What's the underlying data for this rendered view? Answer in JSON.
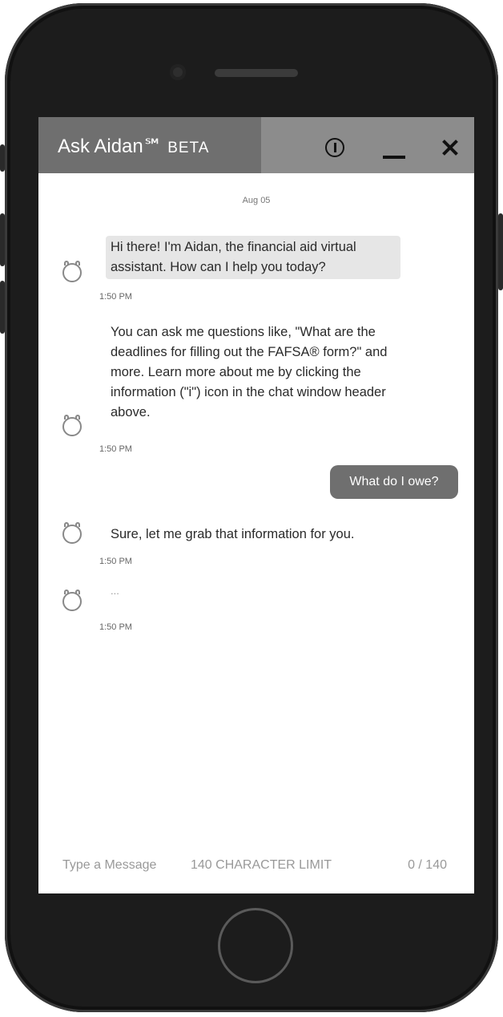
{
  "header": {
    "title": "Ask Aidan℠",
    "beta": "BETA",
    "info_icon": "info-icon",
    "minimize_icon": "minimize-icon",
    "close_icon": "close-icon"
  },
  "chat": {
    "date": "Aug 05",
    "messages": [
      {
        "sender": "bot",
        "text": "Hi there! I'm Aidan, the financial aid virtual assistant. How can I help you today?",
        "time": "1:50 PM"
      },
      {
        "sender": "bot",
        "text": "You can ask me questions like, \"What are the deadlines for filling out the FAFSA® form?\" and more. Learn more about me by clicking the information (\"i\") icon in the chat window header above.",
        "time": "1:50 PM"
      },
      {
        "sender": "user",
        "text": "What do I owe?"
      },
      {
        "sender": "bot",
        "text": "Sure, let me grab that information for you.",
        "time": "1:50 PM"
      },
      {
        "sender": "bot",
        "text": "...",
        "time": "1:50 PM"
      }
    ]
  },
  "composer": {
    "placeholder": "Type a Message",
    "limit_label": "140 CHARACTER LIMIT",
    "counter": "0 / 140"
  }
}
